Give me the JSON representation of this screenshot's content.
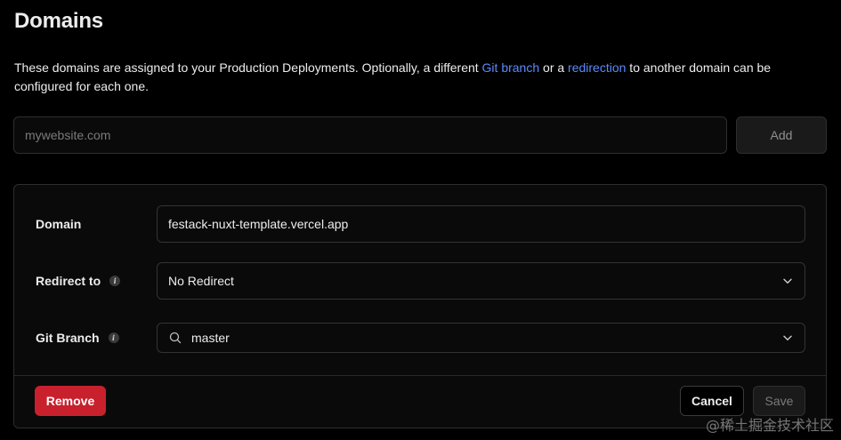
{
  "header": {
    "title": "Domains"
  },
  "description": {
    "part1": "These domains are assigned to your Production Deployments. Optionally, a different ",
    "link1": "Git branch",
    "part2": " or a ",
    "link2": "redirection",
    "part3": " to another domain can be configured for each one.",
    "link_color": "#5a8bff"
  },
  "add_domain": {
    "placeholder": "mywebsite.com",
    "value": "",
    "button_label": "Add"
  },
  "domain_card": {
    "domain_label": "Domain",
    "domain_value": "festack-nuxt-template.vercel.app",
    "redirect_label": "Redirect to",
    "redirect_value": "No Redirect",
    "branch_label": "Git Branch",
    "branch_value": "master",
    "info_icon": "info-icon",
    "remove_label": "Remove",
    "cancel_label": "Cancel",
    "save_label": "Save",
    "danger_color": "#c9202d"
  },
  "watermark": "@稀土掘金技术社区"
}
